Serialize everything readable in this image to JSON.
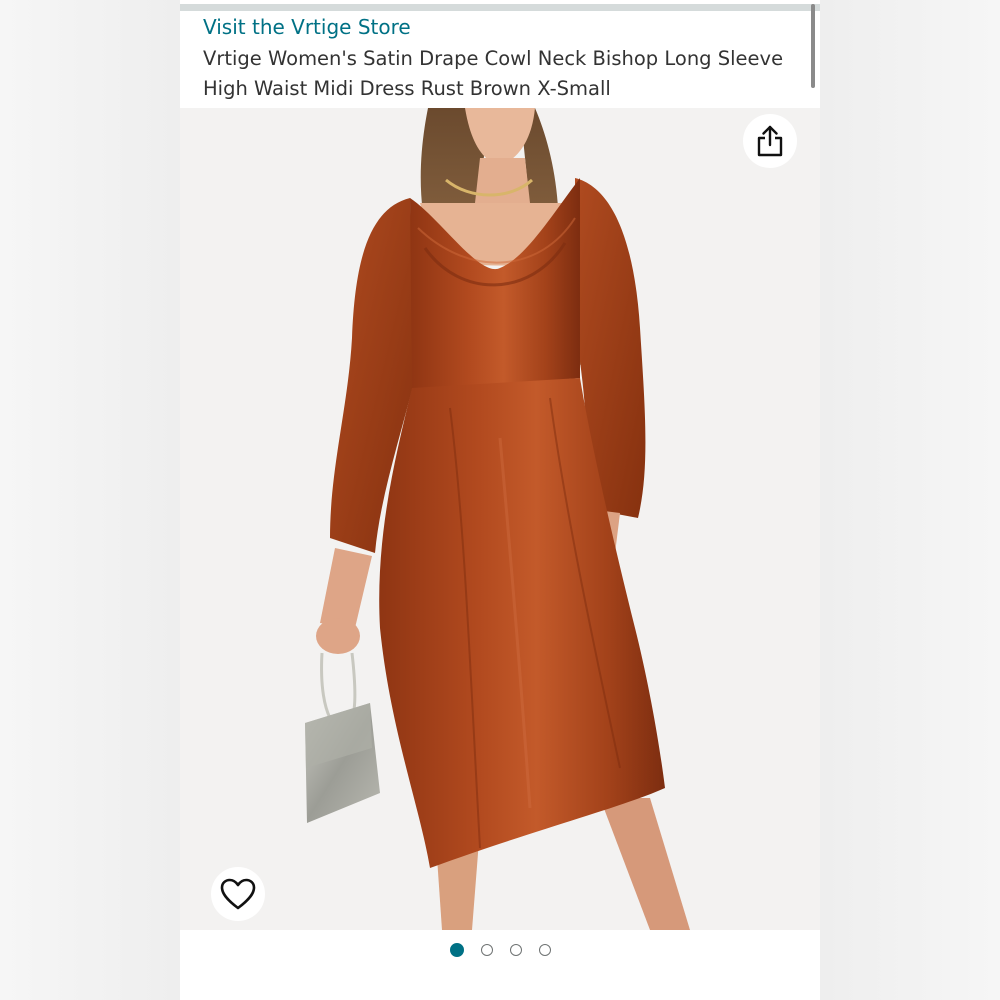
{
  "header": {
    "store_link": "Visit the Vrtige Store",
    "product_title": "Vrtige Women's Satin Drape Cowl Neck Bishop Long Sleeve High Waist Midi Dress Rust Brown X-Small"
  },
  "gallery": {
    "share_icon": "share-icon",
    "wishlist_icon": "heart-icon",
    "image_count": 4,
    "active_index": 0
  },
  "colors": {
    "link": "#007185",
    "title_text": "#333333",
    "dress": "#a8431c",
    "active_dot": "#007185"
  }
}
